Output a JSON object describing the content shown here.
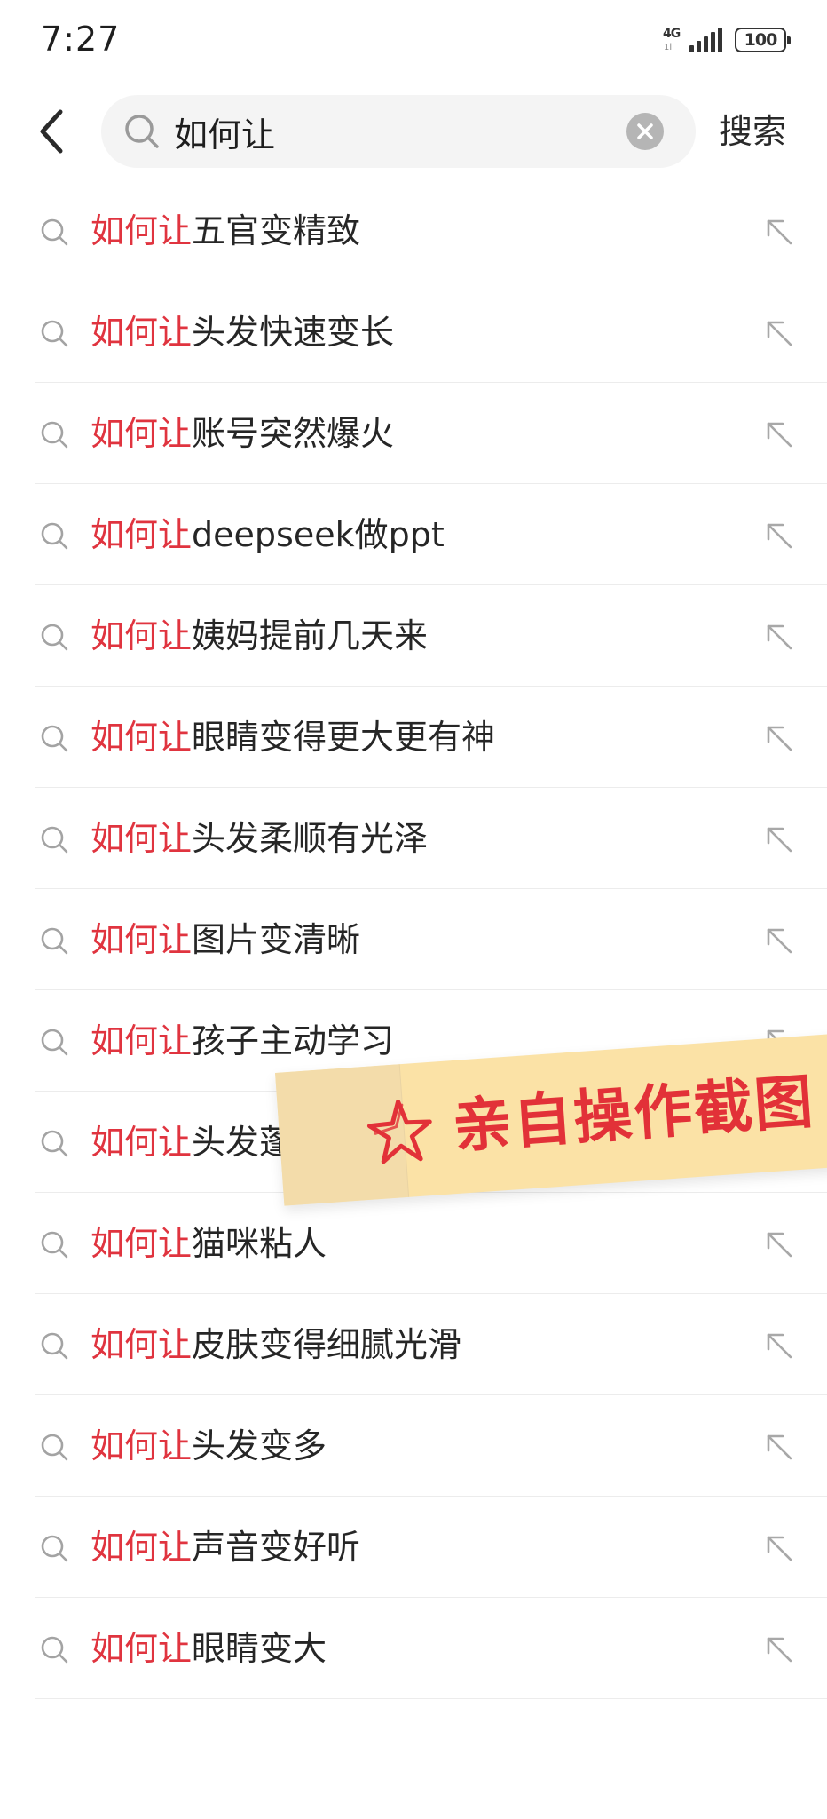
{
  "status_bar": {
    "time": "7:27",
    "network": "4G",
    "network_sub": "1l",
    "battery": "100"
  },
  "search": {
    "query": "如何让",
    "submit_label": "搜索"
  },
  "suggestions": [
    {
      "keyword": "如何让",
      "rest": "五官变精致"
    },
    {
      "keyword": "如何让",
      "rest": "头发快速变长"
    },
    {
      "keyword": "如何让",
      "rest": "账号突然爆火"
    },
    {
      "keyword": "如何让",
      "rest": "deepseek做ppt"
    },
    {
      "keyword": "如何让",
      "rest": "姨妈提前几天来"
    },
    {
      "keyword": "如何让",
      "rest": "眼睛变得更大更有神"
    },
    {
      "keyword": "如何让",
      "rest": "头发柔顺有光泽"
    },
    {
      "keyword": "如何让",
      "rest": "图片变清晰"
    },
    {
      "keyword": "如何让",
      "rest": "孩子主动学习"
    },
    {
      "keyword": "如何让",
      "rest": "头发蓬"
    },
    {
      "keyword": "如何让",
      "rest": "猫咪粘人"
    },
    {
      "keyword": "如何让",
      "rest": "皮肤变得细腻光滑"
    },
    {
      "keyword": "如何让",
      "rest": "头发变多"
    },
    {
      "keyword": "如何让",
      "rest": "声音变好听"
    },
    {
      "keyword": "如何让",
      "rest": "眼睛变大"
    }
  ],
  "overlay": {
    "label": "亲自操作截图"
  },
  "colors": {
    "highlight": "#e0343f",
    "text": "#262626",
    "search_bg": "#f4f4f4",
    "sticker_bg": "#fbe2a6"
  },
  "icons": {
    "back": "back-arrow-icon",
    "search": "search-icon",
    "clear": "clear-circle-icon",
    "fill": "arrow-up-left-icon",
    "star": "hand-drawn-star-icon"
  }
}
